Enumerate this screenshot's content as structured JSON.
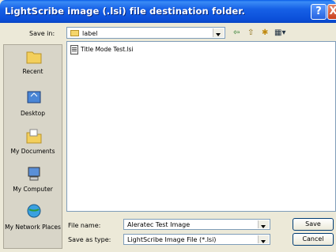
{
  "window": {
    "title": "LightScribe image (.lsi) file destination folder.",
    "help_label": "?",
    "close_label": "X"
  },
  "save_in": {
    "label": "Save in:",
    "value": "label"
  },
  "toolbar": {
    "back": "⇦",
    "up": "⇧",
    "new_folder": "✱",
    "views": "▦▾"
  },
  "places": [
    {
      "label": "Recent",
      "icon": "recent-folder-icon"
    },
    {
      "label": "Desktop",
      "icon": "desktop-icon"
    },
    {
      "label": "My Documents",
      "icon": "my-documents-icon"
    },
    {
      "label": "My Computer",
      "icon": "my-computer-icon"
    },
    {
      "label": "My Network Places",
      "icon": "network-places-icon"
    }
  ],
  "files": [
    {
      "name": "Title Mode Test.lsi"
    }
  ],
  "file_name": {
    "label": "File name:",
    "value": "Aleratec Test Image"
  },
  "save_as_type": {
    "label": "Save as type:",
    "value": "LightScribe Image File (*.lsi)"
  },
  "buttons": {
    "save": "Save",
    "cancel": "Cancel"
  }
}
